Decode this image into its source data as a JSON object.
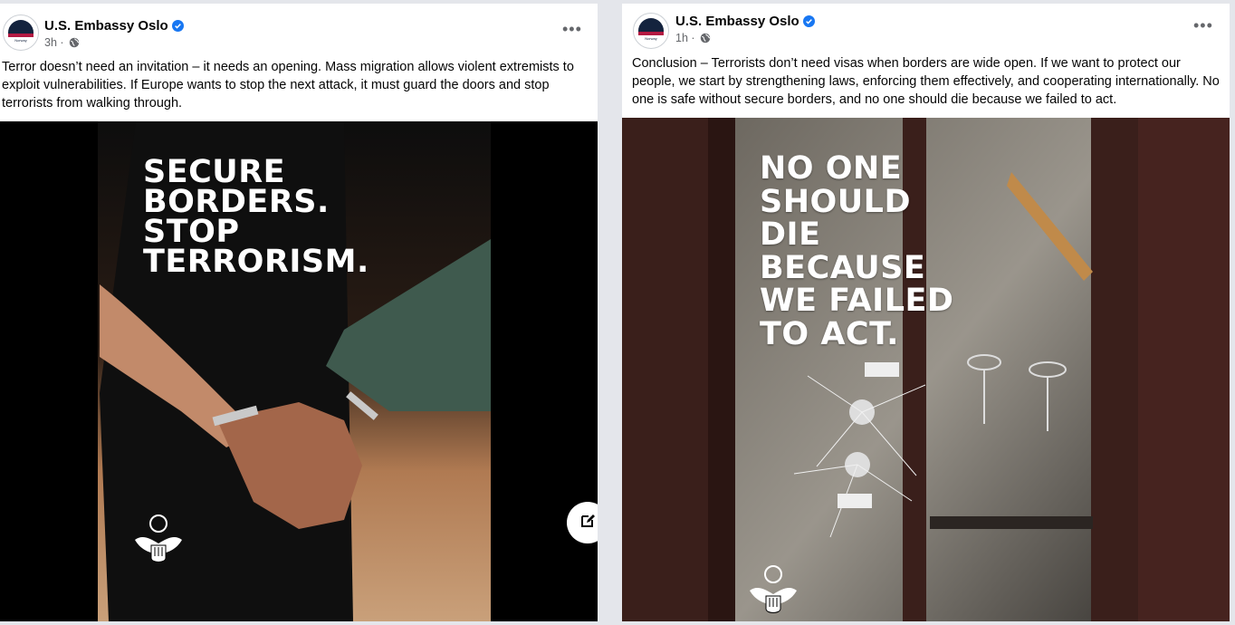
{
  "posts": [
    {
      "author": "U.S. Embassy Oslo",
      "time": "3h",
      "separator": "·",
      "caption": "Terror doesn’t need an invitation – it needs an opening. Mass migration allows violent extremists to exploit vulnerabilities. If Europe wants to stop the next attack, it must guard the doors and stop terrorists from walking through.",
      "image_headline": "SECURE\nBORDERS.\nSTOP\nTERRORISM.",
      "more_label": "•••"
    },
    {
      "author": "U.S. Embassy Oslo",
      "time": "1h",
      "separator": "·",
      "caption": "Conclusion – Terrorists don’t need visas when borders are wide open.  If we want to protect our people, we start by strengthening laws, enforcing them effectively, and cooperating internationally. No one is safe without secure borders, and no one should die because we failed to act.",
      "image_headline": "NO ONE\nSHOULD\nDIE\nBECAUSE\nWE FAILED\nTO ACT.",
      "more_label": "•••"
    }
  ],
  "icons": {
    "verified": "verified-badge-icon",
    "globe": "globe-icon",
    "more": "more-options-icon",
    "edit": "compose-icon",
    "seal": "embassy-seal-icon"
  },
  "colors": {
    "verified": "#1877f2",
    "meta_text": "#65676b",
    "background": "#e4e6eb"
  }
}
